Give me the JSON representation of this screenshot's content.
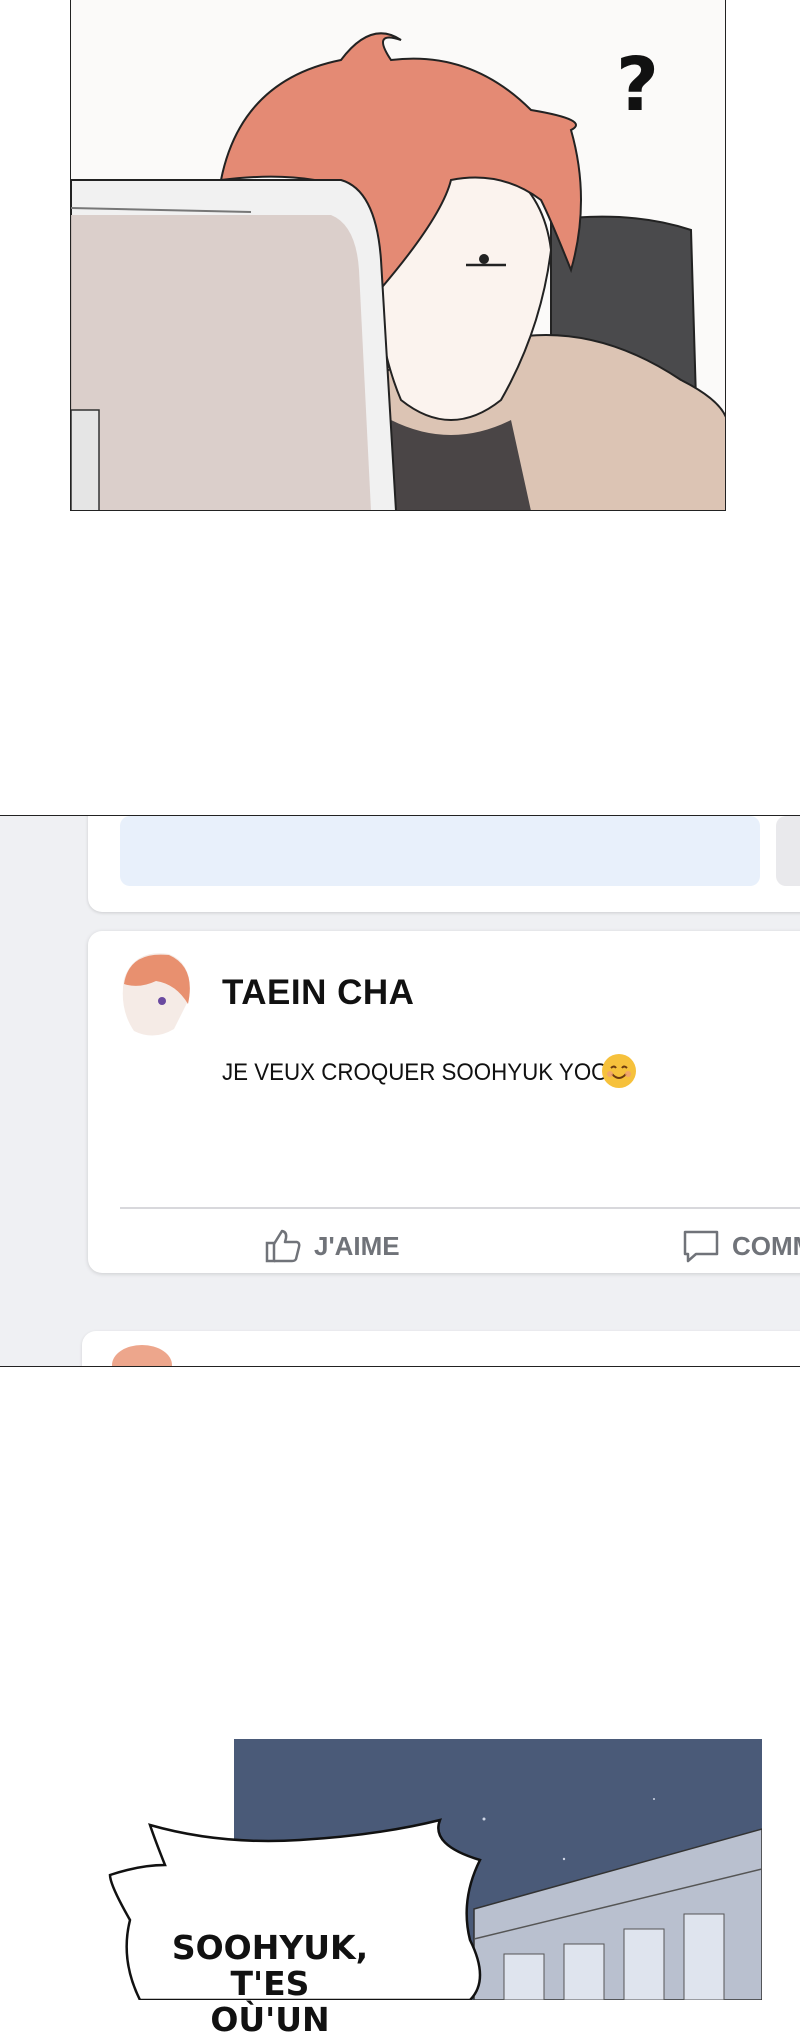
{
  "panel_top": {
    "sfx": "?"
  },
  "feed": {
    "post": {
      "author": "TAEIN CHA",
      "text": "JE VEUX CROQUER SOOHYUK YOO.",
      "emoji_icon": "smiling-face-icon"
    },
    "actions": {
      "like_label": "J'AIME",
      "comment_label": "COMM",
      "like_icon": "thumbs-up-icon",
      "comment_icon": "speech-bubble-icon"
    },
    "colors": {
      "background": "#eff0f3",
      "card": "#ffffff",
      "action_text": "#707379",
      "highlight": "#e8f0fb"
    }
  },
  "panel_bottom": {
    "speech": "SOOHYUK,\nT'ES OÙ'UN"
  }
}
